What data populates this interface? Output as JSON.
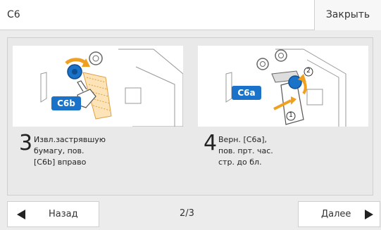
{
  "header": {
    "title": "C6",
    "close_label": "Закрыть"
  },
  "steps": [
    {
      "number": "3",
      "text": "Извл.застрявшую\nбумагу, пов.\n[C6b] вправо",
      "badge": "C6b"
    },
    {
      "number": "4",
      "text": "Верн. [C6a],\nпов. прт. час.\nстр. до бл.",
      "badge": "C6a",
      "marker1": "1",
      "marker2": "2"
    }
  ],
  "footer": {
    "back_label": "Назад",
    "page_indicator": "2/3",
    "next_label": "Далее"
  },
  "colors": {
    "accent_blue": "#1a73c9",
    "arrow_orange": "#f0a020",
    "header_bg": "#ffffff",
    "panel_bg": "#e9e9e9"
  },
  "icons": {
    "back": "triangle-left-icon",
    "next": "triangle-right-icon"
  }
}
